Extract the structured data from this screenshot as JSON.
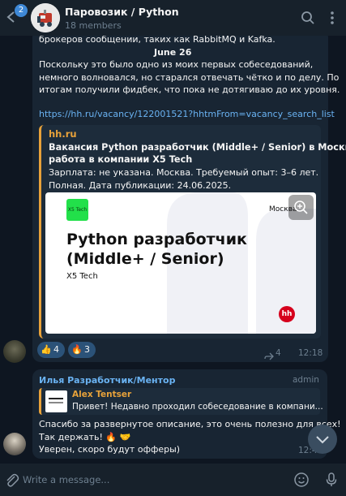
{
  "header": {
    "unread_count": "2",
    "title": "Паровозик / Python",
    "subtitle": "18 members",
    "icons": [
      "back-arrow-icon",
      "search-icon",
      "more-vertical-icon"
    ]
  },
  "message1": {
    "lines_top": [
      "брокеров сообщении, таких как RabbitMQ и Kafka."
    ],
    "date": "June 26",
    "paragraph": [
      "Поскольку это было одно из моих первых собеседований,",
      "немного волновался, но старался отвечать чётко и по делу. По",
      "итогам получили фидбек, что пока не дотягиваю до их уровня."
    ],
    "link": "https://hh.ru/vacancy/122001521?hhtmFrom=vacancy_search_list",
    "preview": {
      "site": "hh.ru",
      "title_lines": [
        "Вакансия Python разработчик (Middle+ / Senior) в Москве,",
        "работа в компании X5 Tech"
      ],
      "desc_lines": [
        "Зарплата: не указана. Москва. Требуемый опыт: 3–6 лет.",
        "Полная. Дата публикации: 24.06.2025."
      ],
      "image": {
        "logo_text": "X5 Tech",
        "city": "Москва",
        "job_lines": [
          "Python разработчик",
          "(Middle+ / Senior)"
        ],
        "company": "X5 Tech",
        "hh_badge": "hh"
      }
    },
    "reactions": [
      {
        "emoji": "👍",
        "count": "4"
      },
      {
        "emoji": "🔥",
        "count": "3"
      }
    ],
    "views": "4",
    "time": "12:18"
  },
  "message2": {
    "sender": "Илья Разработчик/Ментор",
    "role": "admin",
    "reply": {
      "name": "Alex Tentser",
      "text": "Привет! Недавно проходил собеседование в компани..."
    },
    "lines": [
      "Спасибо за развернутое описание, это очень полезно для всех!",
      "Так держать! 🔥 🤝",
      "Уверен, скоро будут офферы)"
    ],
    "time": "12:45"
  },
  "input": {
    "placeholder": "Write a message..."
  },
  "colors": {
    "background": "#0e1621",
    "bubble": "#182533",
    "accent": "#6ab3f3",
    "preview_border": "#e8a23a"
  }
}
